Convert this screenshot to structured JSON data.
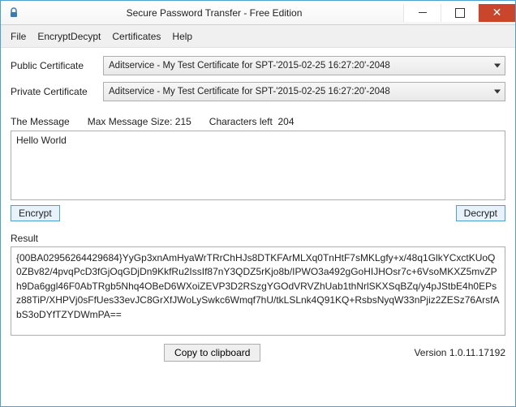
{
  "title": "Secure Password Transfer - Free Edition",
  "menu": {
    "file": "File",
    "encryptDecrypt": "EncryptDecypt",
    "certificates": "Certificates",
    "help": "Help"
  },
  "labels": {
    "publicCert": "Public Certificate",
    "privateCert": "Private Certificate",
    "theMessage": "The Message",
    "maxMsgSize": "Max Message Size:",
    "charsLeft": "Characters left",
    "result": "Result",
    "version": "Version"
  },
  "combos": {
    "publicCert": "Aditservice - My Test Certificate for SPT-'2015-02-25 16:27:20'-2048",
    "privateCert": "Aditservice - My Test Certificate for SPT-'2015-02-25 16:27:20'-2048"
  },
  "stats": {
    "maxSize": "215",
    "charsLeft": "204"
  },
  "message": "Hello World",
  "buttons": {
    "encrypt": "Encrypt",
    "decrypt": "Decrypt",
    "copy": "Copy to clipboard"
  },
  "result": "{00BA02956264429684}YyGp3xnAmHyaWrTRrChHJs8DTKFArMLXq0TnHtF7sMKLgfy+x/48q1GlkYCxctKUoQ0ZBv82/4pvqPcD3fGjOqGDjDn9KkfRu2IssIf87nY3QDZ5rKjo8b/IPWO3a492gGoHIJHOsr7c+6VsoMKXZ5mvZPh9Da6ggl46F0AbTRgb5Nhq4OBeD6WXoiZEVP3D2RSzgYGOdVRVZhUab1thNrlSKXSqBZq/y4pJStbE4h0EPsz88TiP/XHPVj0sFfUes33evJC8GrXfJWoLySwkc6Wmqf7hU/tkLSLnk4Q91KQ+RsbsNyqW33nPjiz2ZESz76ArsfAbS3oDYfTZYDWmPA==",
  "version": "1.0.11.17192"
}
